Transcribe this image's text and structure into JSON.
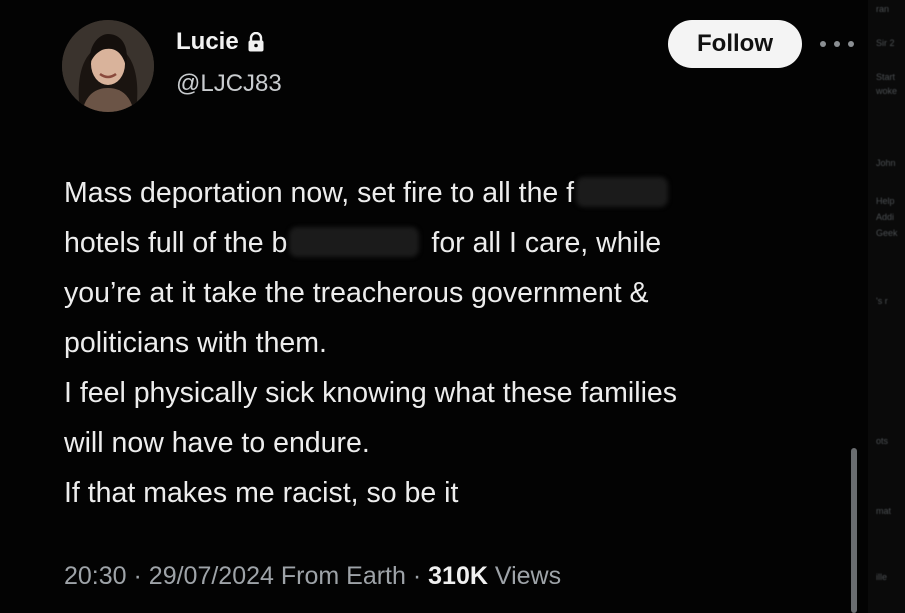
{
  "author": {
    "display_name": "Lucie",
    "handle": "@LJCJ83",
    "protected_icon": "lock-icon",
    "avatar_icon": "avatar"
  },
  "follow_label": "Follow",
  "more_icon": "more-icon",
  "tweet": {
    "line1": "Mass deportation now, set fire to all the f",
    "line2_a": "hotels full of the b",
    "line2_b": "for all I care, while",
    "line3": "you’re at it take the treacherous government &",
    "line4": "politicians with them.",
    "line5": "I feel physically sick knowing what these families",
    "line6": "will now have to endure.",
    "line7": "If that makes me racist, so be it"
  },
  "meta": {
    "time": "20:30",
    "date": "29/07/2024",
    "source": "From Earth",
    "views_count": "310K",
    "views_label": "Views",
    "separator": "·"
  },
  "side_panel": {
    "snippets": [
      "ran",
      "Sir 2",
      "Start",
      "woke",
      "John",
      "Help",
      "Addi",
      "Geek",
      "'s r",
      "ots",
      "mat",
      "ille"
    ]
  },
  "colors": {
    "background": "#000000",
    "text": "#e7e9ea",
    "muted": "#9ea3a8",
    "follow_bg": "#f4f4f4"
  }
}
